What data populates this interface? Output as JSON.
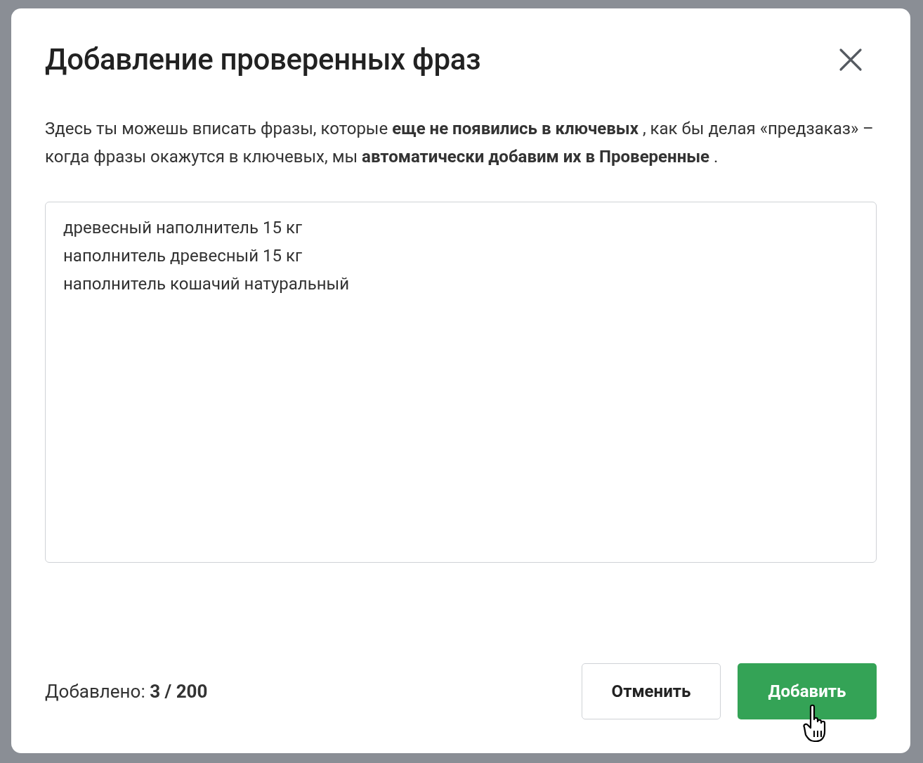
{
  "dialog": {
    "title": "Добавление проверенных фраз",
    "description": "Здесь ты можешь вписать фразы, которые **еще не появились в ключевых** , как бы делая «предзаказ» – когда фразы окажутся в ключевых, мы **автоматически добавим их в Проверенные** .",
    "phrases_field": {
      "lines": [
        "древесный наполнитель 15 кг",
        "наполнитель древесный 15 кг",
        "наполнитель кошачий натуральный"
      ]
    },
    "counter": "Добавлено: **3 / 200**",
    "buttons": [
      {
        "label": "Отменить",
        "kind": "secondary"
      },
      {
        "label": "Добавить",
        "kind": "primary"
      }
    ]
  }
}
